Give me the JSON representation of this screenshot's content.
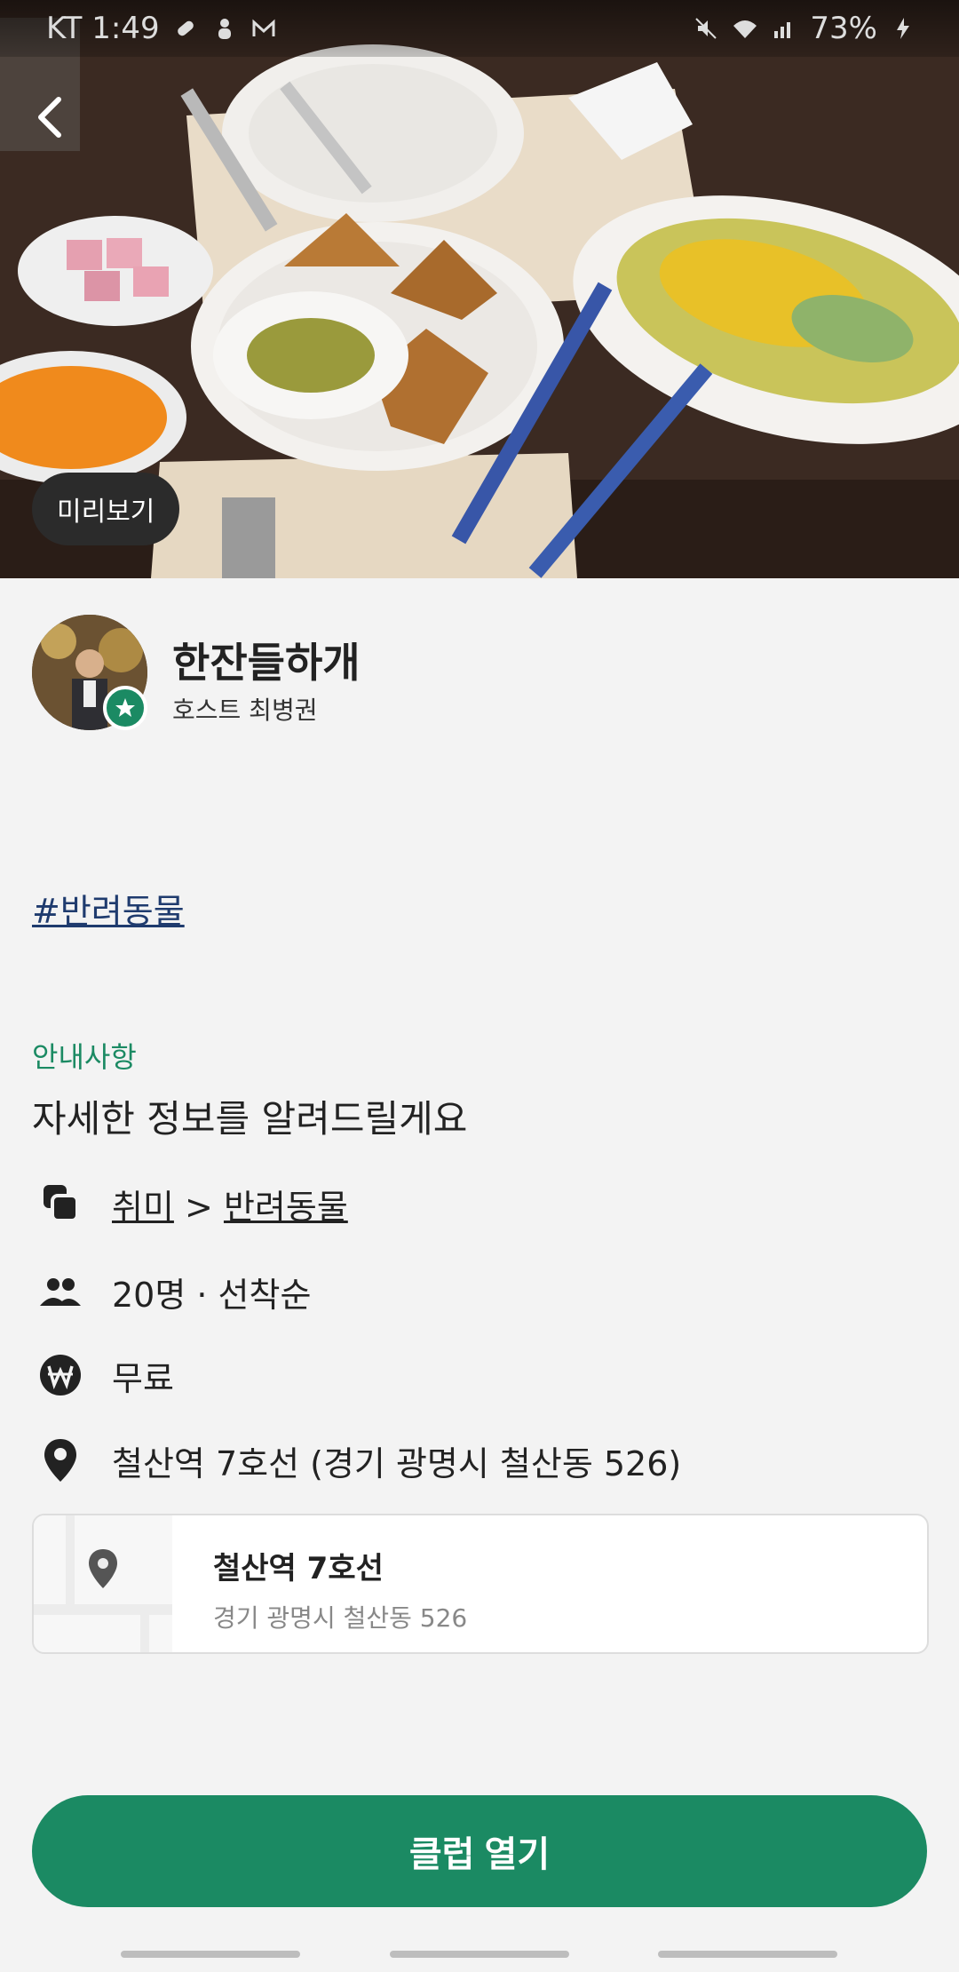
{
  "status_bar": {
    "carrier_time": "KT 1:49",
    "battery": "73%"
  },
  "hero": {
    "back_icon": "chevron-left-icon",
    "preview_label": "미리보기"
  },
  "host": {
    "club_name": "한잔들하개",
    "host_label": "호스트 최병권",
    "badge_icon": "star-icon"
  },
  "hashtag": "#반려동물",
  "info": {
    "section_label": "안내사항",
    "section_title": "자세한 정보를 알려드릴게요",
    "category_main": "취미",
    "category_sep": ">",
    "category_sub": "반려동물",
    "capacity": "20명 · 선착순",
    "fee": "무료",
    "location": "철산역 7호선 (경기 광명시 철산동 526)"
  },
  "map_card": {
    "title": "철산역 7호선",
    "address": "경기 광명시 철산동 526"
  },
  "cta": {
    "label": "클럽 열기"
  },
  "colors": {
    "accent": "#1b8a63",
    "hashtag": "#1f3b6e"
  }
}
